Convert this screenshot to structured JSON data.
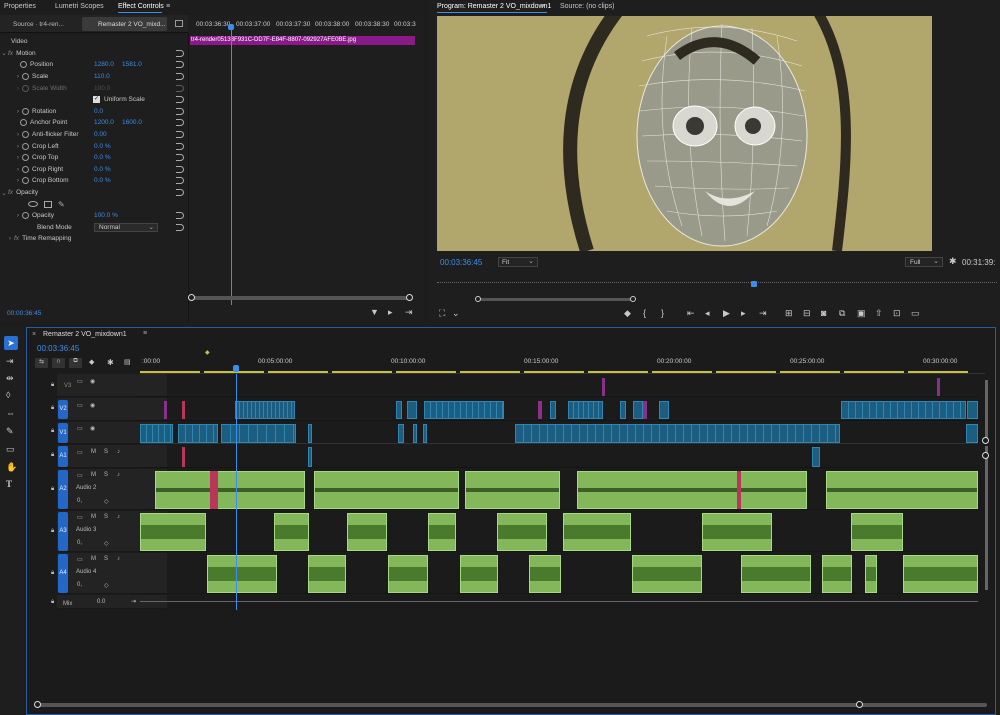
{
  "top_left_tabs": [
    "Properties",
    "Lumetri Scopes",
    "Effect Controls"
  ],
  "source_tab": "Source · tr4-ren...",
  "sequence_tab": "Remaster 2 VO_mixd...",
  "ec_ruler": [
    "00:03:36:30",
    "00:03:37:00",
    "00:03:37:30",
    "00:03:38:00",
    "00:03:38:30",
    "00:03:3"
  ],
  "clip_name": "tr4-render05133F931C-DD7F-E84F-8807-092927AFE0BE.jpg",
  "video_header": "Video",
  "motion_label": "Motion",
  "props": {
    "position": {
      "label": "Position",
      "v1": "1280.0",
      "v2": "1581.0"
    },
    "scale": {
      "label": "Scale",
      "v1": "110.0"
    },
    "scale_width": {
      "label": "Scale Width",
      "v1": "100.0"
    },
    "uniform_scale": "Uniform Scale",
    "rotation": {
      "label": "Rotation",
      "v1": "0.0"
    },
    "anchor": {
      "label": "Anchor Point",
      "v1": "1200.0",
      "v2": "1600.0"
    },
    "antiflicker": {
      "label": "Anti-flicker Filter",
      "v1": "0.00"
    },
    "crop_left": {
      "label": "Crop Left",
      "v1": "0.0 %"
    },
    "crop_top": {
      "label": "Crop Top",
      "v1": "0.0 %"
    },
    "crop_right": {
      "label": "Crop Right",
      "v1": "0.0 %"
    },
    "crop_bottom": {
      "label": "Crop Bottom",
      "v1": "0.0 %"
    },
    "opacity_header": "Opacity",
    "opacity": {
      "label": "Opacity",
      "v1": "100.0 %"
    },
    "blend": {
      "label": "Blend Mode",
      "v1": "Normal"
    },
    "time_remap": "Time Remapping"
  },
  "ec_timecode": "00:00:36:45",
  "program_tab": "Program: Remaster 2 VO_mixdown1",
  "source_clips_tab": "Source: (no clips)",
  "program_timecode": "00:03:36:45",
  "fit_label": "Fit",
  "full_label": "Full",
  "program_duration": "00:31:39:",
  "timeline_tab": "Remaster 2 VO_mixdown1",
  "timeline_timecode": "00:03:36:45",
  "timeline_ruler": [
    ":00:00",
    "00:05:00:00",
    "00:10:00:00",
    "00:15:00:00",
    "00:20:00:00",
    "00:25:00:00",
    "00:30:00:00"
  ],
  "tracks": {
    "v3": "V3",
    "v2": "V2",
    "v1": "V1",
    "a1": "A1",
    "a2": "A2",
    "a3": "A3",
    "a4": "A4",
    "audio2": "Audio 2",
    "audio3": "Audio 3",
    "audio4": "Audio 4",
    "mix": "Mix",
    "mix_val": "0.0"
  },
  "colors": {
    "accent": "#3b8fe8",
    "video_clip": "#1b5e82",
    "audio_clip": "#82b85a",
    "preview_bg": "#b1a66b"
  }
}
